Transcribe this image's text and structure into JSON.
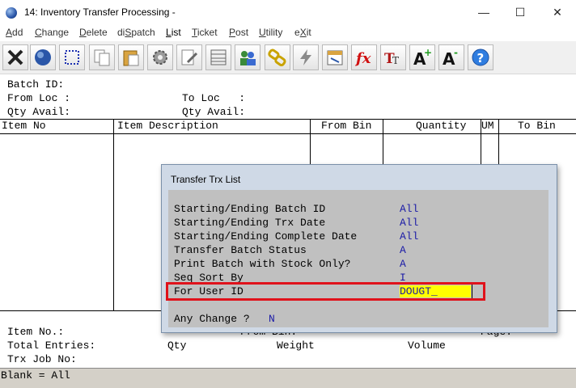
{
  "window": {
    "title": "14: Inventory Transfer Processing -",
    "minimize": "—",
    "maximize": "☐",
    "close": "✕"
  },
  "menu": [
    "Add",
    "Change",
    "Delete",
    "diSpatch",
    "List",
    "Ticket",
    "Post",
    "Utility",
    "eXit"
  ],
  "toolbar_icons": [
    "close-x-icon",
    "globe-icon",
    "select-rect-icon",
    "copy-icon",
    "paste-icon",
    "settings-gear-icon",
    "edit-doc-icon",
    "grid-icon",
    "users-icon",
    "chain-icon",
    "lightning-icon",
    "calendar-icon",
    "fx-icon",
    "text-font-icon",
    "font-increase-icon",
    "font-decrease-icon",
    "help-icon"
  ],
  "header": {
    "batch_id_label": "Batch ID:",
    "from_loc_label": "From Loc :",
    "to_loc_label": "To Loc   :",
    "qty_avail_left": "Qty Avail:",
    "qty_avail_right": "Qty Avail:"
  },
  "columns": [
    "Item No",
    "Item Description",
    "From Bin",
    "Quantity",
    "UM",
    "To Bin"
  ],
  "footer": {
    "item_no_label": "Item No.:",
    "from_bin_label": "From Bin:",
    "page_label": "Page:",
    "total_entries_label": "Total Entries:",
    "qty_label": "Qty",
    "weight_label": "Weight",
    "volume_label": "Volume",
    "trx_job_label": "Trx Job No:",
    "status": "Blank = All"
  },
  "dialog": {
    "title": "Transfer Trx List",
    "rows": [
      {
        "label": "Starting/Ending Batch ID",
        "value": "All"
      },
      {
        "label": "Starting/Ending Trx Date",
        "value": "All"
      },
      {
        "label": "Starting/Ending Complete Date",
        "value": "All"
      },
      {
        "label": "Transfer Batch Status",
        "value": "A"
      },
      {
        "label": "Print Batch with Stock Only?",
        "value": "A"
      },
      {
        "label": "Seq Sort By",
        "value": "I"
      },
      {
        "label": "For User ID",
        "value": "DOUGT_"
      }
    ],
    "prompt": "Any Change ?",
    "prompt_value": "N"
  },
  "colors": {
    "highlight_border": "#e0121b",
    "input_bg": "#ffff00",
    "value_text": "#1a1aa6"
  }
}
